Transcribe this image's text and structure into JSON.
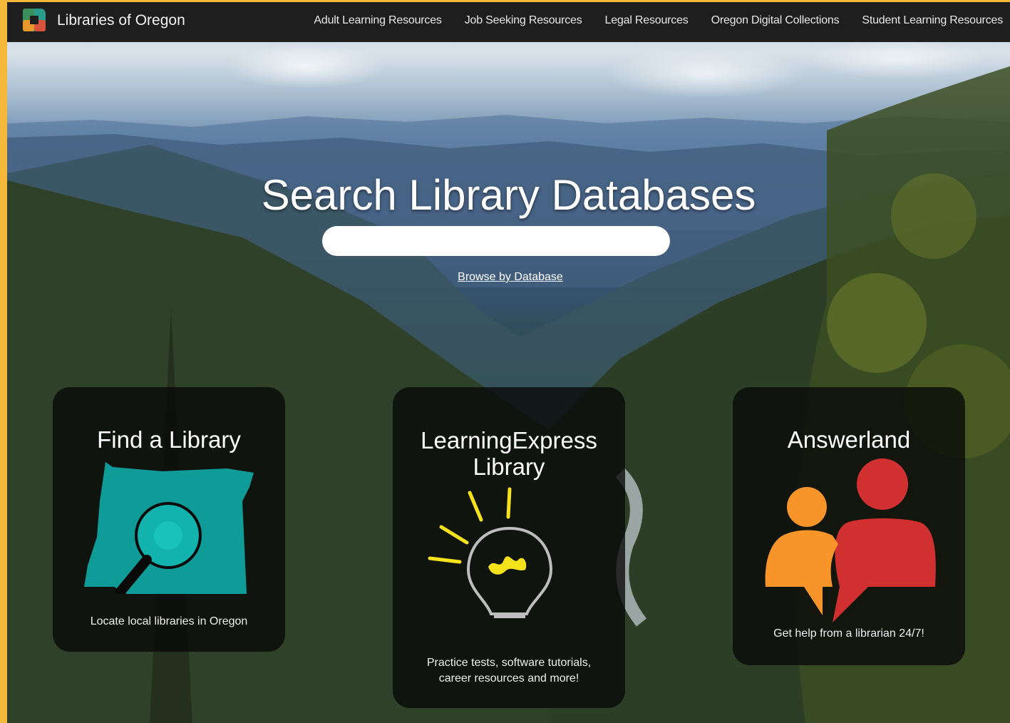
{
  "header": {
    "site_title": "Libraries of Oregon",
    "logo_icon": "checker-square-logo-icon",
    "nav": [
      {
        "label": "Adult Learning Resources"
      },
      {
        "label": "Job Seeking Resources"
      },
      {
        "label": "Legal Resources"
      },
      {
        "label": "Oregon Digital Collections"
      },
      {
        "label": "Student Learning Resources"
      }
    ]
  },
  "hero": {
    "title": "Search Library Databases",
    "search_value": "",
    "browse_link": "Browse by Database"
  },
  "cards": [
    {
      "title": "Find a Library",
      "description": "Locate local libraries in Oregon",
      "icon": "oregon-map-magnifier-icon",
      "accent": "#0f9b97"
    },
    {
      "title": "LearningExpress Library",
      "description": "Practice tests, software tutorials, career resources and more!",
      "icon": "lightbulb-icon",
      "accent": "#f5e21a"
    },
    {
      "title": "Answerland",
      "description": "Get help from a librarian 24/7!",
      "icon": "people-chat-icon",
      "accent": "#d03030"
    }
  ],
  "colors": {
    "frame_border": "#f5b83a",
    "header_bg": "#1e1e1e"
  }
}
